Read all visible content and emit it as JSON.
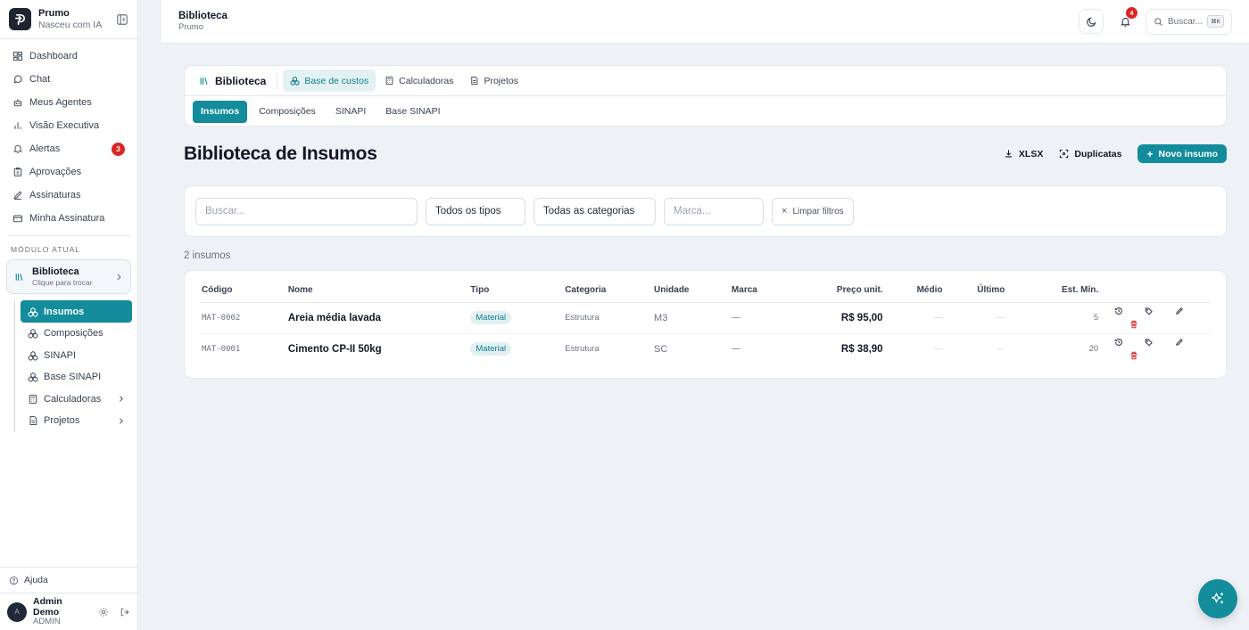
{
  "brand": {
    "name": "Prumo",
    "tagline": "Nasceu com IA"
  },
  "sidebar": {
    "items": [
      {
        "label": "Dashboard",
        "icon": "dashboard-icon"
      },
      {
        "label": "Chat",
        "icon": "chat-icon"
      },
      {
        "label": "Meus Agentes",
        "icon": "robot-icon"
      },
      {
        "label": "Visão Executiva",
        "icon": "bar-chart-icon"
      },
      {
        "label": "Alertas",
        "icon": "bell-icon",
        "badge": "3"
      },
      {
        "label": "Aprovações",
        "icon": "clipboard-icon"
      },
      {
        "label": "Assinaturas",
        "icon": "pen-icon"
      },
      {
        "label": "Minha Assinatura",
        "icon": "credit-card-icon"
      }
    ],
    "section_label": "MÓDULO ATUAL",
    "module": {
      "title": "Biblioteca",
      "subtitle": "Clique para trocar"
    },
    "sub_items": [
      {
        "label": "Insumos",
        "active": true
      },
      {
        "label": "Composições"
      },
      {
        "label": "SINAPI"
      },
      {
        "label": "Base SINAPI"
      },
      {
        "label": "Calculadoras"
      },
      {
        "label": "Projetos"
      }
    ],
    "help": "Ajuda",
    "user": {
      "name": "Admin Demo",
      "role": "ADMIN"
    }
  },
  "topbar": {
    "title": "Biblioteca",
    "subtitle": "Prumo",
    "notification_count": "4",
    "search_placeholder": "Buscar...",
    "shortcut": "⌘K"
  },
  "tabs": {
    "library_title": "Biblioteca",
    "main": [
      "Base de custos",
      "Calculadoras",
      "Projetos"
    ],
    "sub": [
      "Insumos",
      "Composições",
      "SINAPI",
      "Base SINAPI"
    ]
  },
  "page": {
    "title": "Biblioteca de Insumos",
    "xlsx_label": "XLSX",
    "duplicates_label": "Duplicatas",
    "new_label": "Novo insumo"
  },
  "filters": {
    "search_placeholder": "Buscar...",
    "type_value": "Todos os tipos",
    "category_value": "Todas as categorias",
    "brand_placeholder": "Marca...",
    "clear_label": "Limpar filtros"
  },
  "count_text": "2 insumos",
  "table": {
    "headers": [
      "Código",
      "Nome",
      "Tipo",
      "Categoria",
      "Unidade",
      "Marca",
      "Preço unit.",
      "Médio",
      "Último",
      "Est. Mín."
    ],
    "rows": [
      {
        "code": "MAT-0002",
        "name": "Areia média lavada",
        "type": "Material",
        "category": "Estrutura",
        "unit": "M3",
        "brand": "—",
        "price": "R$ 95,00",
        "avg": "—",
        "last": "—",
        "min_stock": "5"
      },
      {
        "code": "MAT-0001",
        "name": "Cimento CP-II 50kg",
        "type": "Material",
        "category": "Estrutura",
        "unit": "SC",
        "brand": "—",
        "price": "R$ 38,90",
        "avg": "—",
        "last": "—",
        "min_stock": "20"
      }
    ]
  },
  "colors": {
    "accent": "#138c9c",
    "danger": "#dc2626"
  }
}
